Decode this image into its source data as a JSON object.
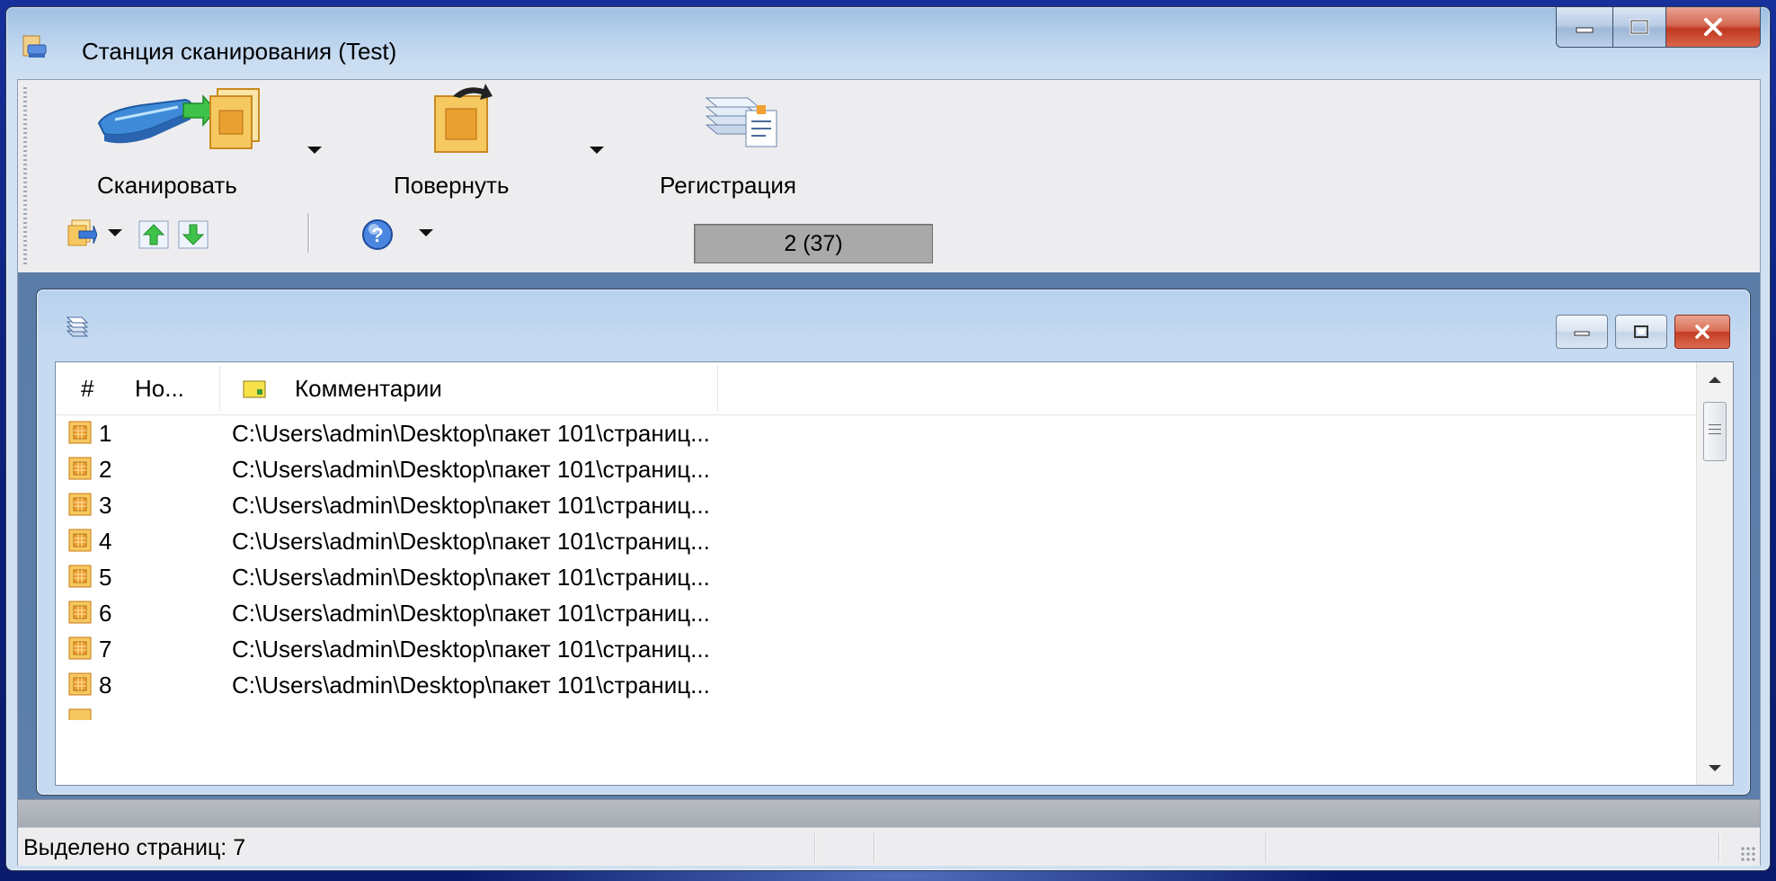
{
  "window": {
    "title": "Станция сканирования (Test)"
  },
  "toolbar": {
    "scan_label": "Сканировать",
    "rotate_label": "Повернуть",
    "register_label": "Регистрация",
    "page_counter": "2 (37)"
  },
  "list": {
    "columns": {
      "num": "#",
      "name": "Но...",
      "comments": "Комментарии"
    },
    "rows": [
      {
        "num": "1",
        "path": "C:\\Users\\admin\\Desktop\\пакет 101\\страниц..."
      },
      {
        "num": "2",
        "path": "C:\\Users\\admin\\Desktop\\пакет 101\\страниц..."
      },
      {
        "num": "3",
        "path": "C:\\Users\\admin\\Desktop\\пакет 101\\страниц..."
      },
      {
        "num": "4",
        "path": "C:\\Users\\admin\\Desktop\\пакет 101\\страниц..."
      },
      {
        "num": "5",
        "path": "C:\\Users\\admin\\Desktop\\пакет 101\\страниц..."
      },
      {
        "num": "6",
        "path": "C:\\Users\\admin\\Desktop\\пакет 101\\страниц..."
      },
      {
        "num": "7",
        "path": "C:\\Users\\admin\\Desktop\\пакет 101\\страниц..."
      },
      {
        "num": "8",
        "path": "C:\\Users\\admin\\Desktop\\пакет 101\\страниц..."
      }
    ]
  },
  "statusbar": {
    "text": "Выделено страниц: 7"
  },
  "icons": {
    "app": "scan-station-icon",
    "scan": "scanner-icon",
    "rotate": "rotate-page-icon",
    "register": "register-documents-icon",
    "export": "export-icon",
    "move_up": "arrow-up-icon",
    "move_down": "arrow-down-icon",
    "help": "help-icon",
    "page": "page-icon",
    "comment": "comment-icon"
  },
  "colors": {
    "page_icon": "#f0a030",
    "close_button": "#c8452a",
    "mdi_background": "#5b7fae"
  }
}
